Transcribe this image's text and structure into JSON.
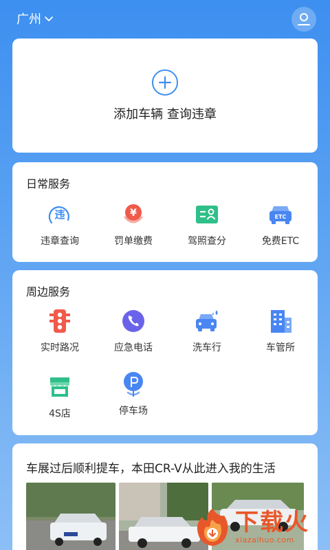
{
  "header": {
    "city": "广州"
  },
  "add_vehicle": {
    "label": "添加车辆 查询违章"
  },
  "daily_services": {
    "title": "日常服务",
    "items": [
      {
        "label": "违章查询",
        "icon": "violation-query-icon"
      },
      {
        "label": "罚单缴费",
        "icon": "fine-payment-icon"
      },
      {
        "label": "驾照查分",
        "icon": "license-score-icon"
      },
      {
        "label": "免费ETC",
        "icon": "etc-icon"
      }
    ]
  },
  "nearby_services": {
    "title": "周边服务",
    "items": [
      {
        "label": "实时路况",
        "icon": "traffic-light-icon"
      },
      {
        "label": "应急电话",
        "icon": "phone-icon"
      },
      {
        "label": "洗车行",
        "icon": "car-wash-icon"
      },
      {
        "label": "车管所",
        "icon": "building-icon"
      },
      {
        "label": "4S店",
        "icon": "store-icon"
      },
      {
        "label": "停车场",
        "icon": "parking-icon"
      }
    ]
  },
  "news": {
    "title": "车展过后顺利提车，本田CR-V从此进入我的生活"
  },
  "watermark": {
    "name": "下载火",
    "url": "xiazaihuo.com"
  },
  "colors": {
    "accent": "#3e8ef0",
    "fine_red": "#f05a4a",
    "license_green": "#2fbf8a",
    "etc_blue": "#4a86f2",
    "phone_purple": "#6a63ea",
    "store_green": "#2fbf8a",
    "watermark_orange": "#e8572a"
  }
}
